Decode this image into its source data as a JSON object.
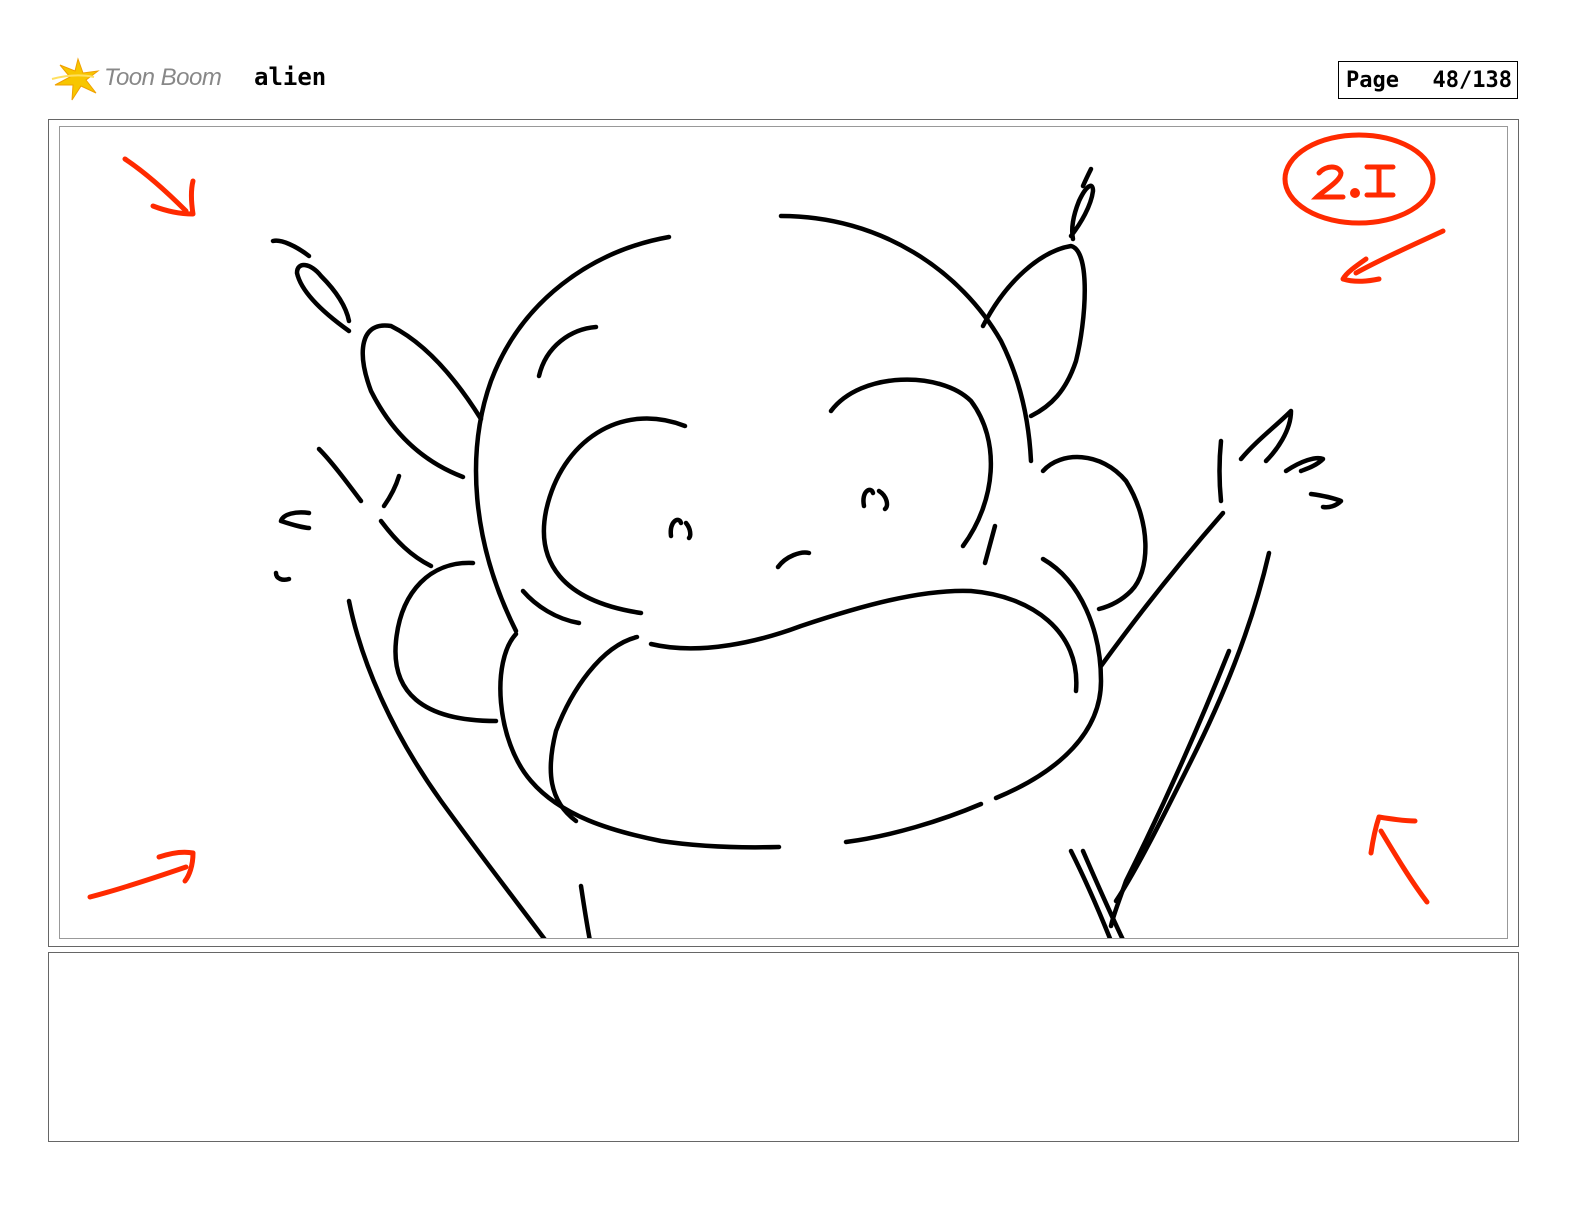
{
  "header": {
    "logo_text": "Toon Boom",
    "project_title": "alien",
    "page_label": "Page",
    "page_number": "48/138"
  },
  "panel": {
    "annotation_label": "2.I"
  },
  "notes": {
    "text": ""
  },
  "colors": {
    "annotation": "#ff2a00",
    "ink": "#000000",
    "logo_star": "#f7c600"
  }
}
